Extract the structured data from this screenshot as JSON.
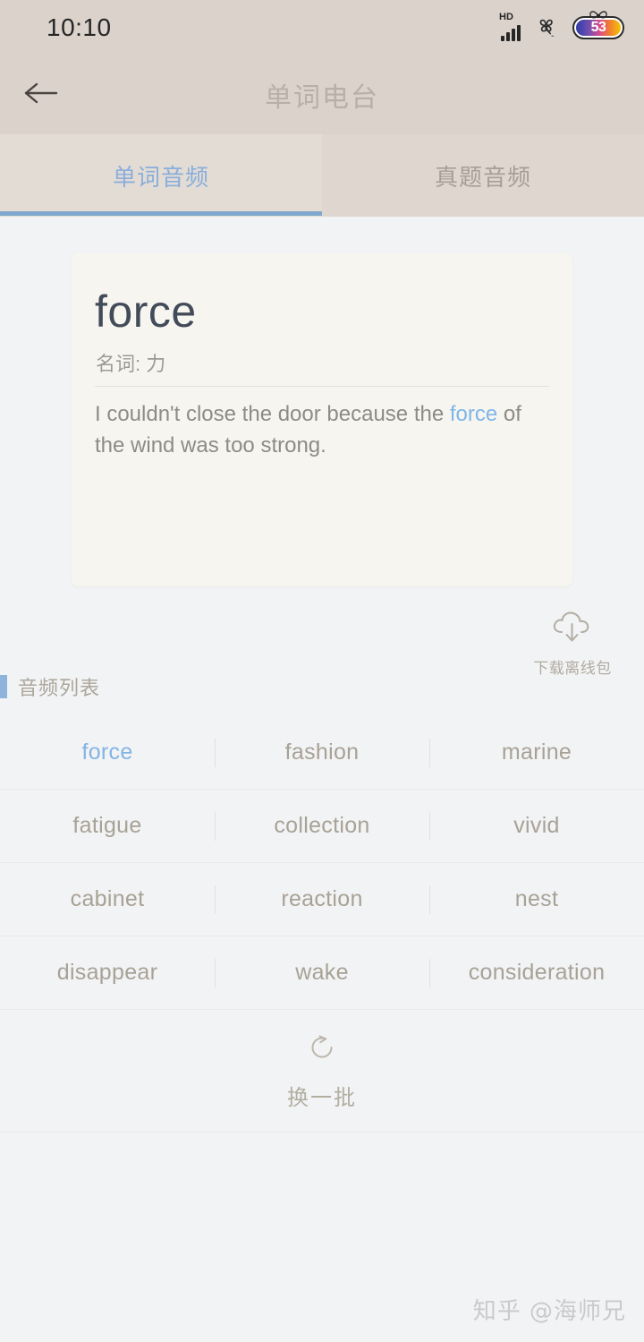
{
  "status_bar": {
    "time": "10:10",
    "network_label": "HD",
    "signal_icon": "signal-bars-icon",
    "clover_icon": "clover-icon",
    "battery_level": "53",
    "battery_icon": "battery-icon",
    "bow_icon": "bow-icon"
  },
  "header": {
    "back_icon": "back-arrow-icon",
    "title": "单词电台"
  },
  "tabs": [
    {
      "label": "单词音频",
      "active": true
    },
    {
      "label": "真题音频",
      "active": false
    }
  ],
  "word_card": {
    "word": "force",
    "part_of_speech": "名词: 力",
    "sentence_before": "I couldn't close the door because the ",
    "sentence_highlight": "force",
    "sentence_after": " of the wind was too strong."
  },
  "download": {
    "icon": "cloud-download-icon",
    "label": "下载离线包"
  },
  "audio_list": {
    "heading": "音频列表",
    "rows": [
      [
        "force",
        "fashion",
        "marine"
      ],
      [
        "fatigue",
        "collection",
        "vivid"
      ],
      [
        "cabinet",
        "reaction",
        "nest"
      ],
      [
        "disappear",
        "wake",
        "consideration"
      ]
    ],
    "selected_word": "force"
  },
  "refresh": {
    "icon": "refresh-icon",
    "label": "换一批"
  },
  "watermark": "知乎 @海师兄",
  "colors": {
    "header_bg": "#DAD2CB",
    "tab_bg": "#E0D8D1",
    "accent_blue": "#7FA8CE",
    "active_tab_text": "#8AAEDB",
    "page_bg": "#F2F3F5",
    "card_bg": "#F7F5F0",
    "word_text": "#A8A296",
    "highlight_blue": "#7EB6E8"
  }
}
